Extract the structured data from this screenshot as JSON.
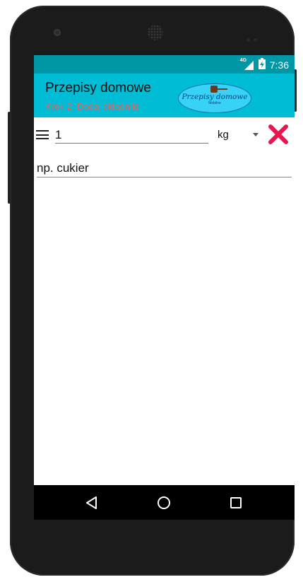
{
  "status_bar": {
    "network": "4G",
    "time": "7:36"
  },
  "app_bar": {
    "title": "Przepisy domowe",
    "subtitle": "Krok 2: Dodaj składniki",
    "logo": {
      "title": "Przepisy domowe",
      "subtext": "Mobilne"
    }
  },
  "ingredient": {
    "quantity_value": "1",
    "unit_selected": "kg",
    "name_placeholder": "np. cukier"
  },
  "fabs": {
    "prev_icon": "skip-previous-icon",
    "add_label": "+",
    "next_icon": "skip-next-icon"
  },
  "colors": {
    "status_bar": "#0097a7",
    "app_bar": "#00bcd4",
    "subtitle": "#d86a6a",
    "delete_icon": "#e8164f",
    "fab_nav": "#9fa8da",
    "fab_add": "#cddc39"
  },
  "navigation_bar": {
    "icons": [
      "back-icon",
      "home-icon",
      "recents-icon"
    ]
  }
}
